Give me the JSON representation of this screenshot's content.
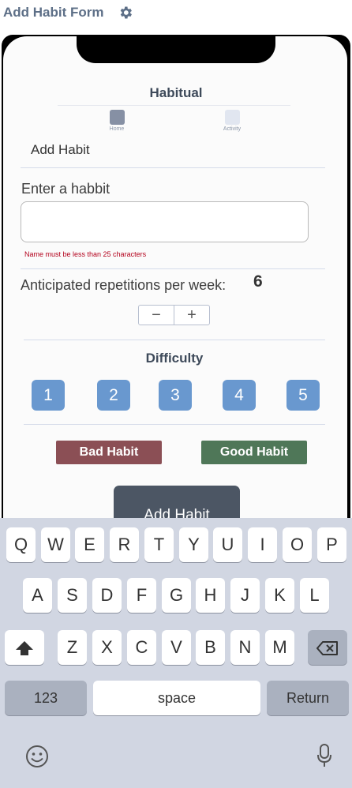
{
  "window": {
    "title": "Add Habit Form",
    "settings_icon": "gear-icon"
  },
  "app": {
    "title": "Habitual",
    "tabs": [
      {
        "label": "Home",
        "icon": "home-icon",
        "active": true
      },
      {
        "label": "Activity",
        "icon": "activity-icon",
        "active": false
      }
    ]
  },
  "form": {
    "heading": "Add Habit",
    "name_label": "Enter a habbit",
    "name_value": "",
    "name_error": "Name must be less than 25 characters",
    "reps_label": "Anticipated repetitions per week:",
    "reps_value": "6",
    "stepper": {
      "minus": "−",
      "plus": "+"
    },
    "difficulty_label": "Difficulty",
    "difficulty_options": [
      "1",
      "2",
      "3",
      "4",
      "5"
    ],
    "bad_habit_label": "Bad Habit",
    "good_habit_label": "Good Habit",
    "submit_label": "Add Habit"
  },
  "keyboard": {
    "row1": [
      "Q",
      "W",
      "E",
      "R",
      "T",
      "Y",
      "U",
      "I",
      "O",
      "P"
    ],
    "row2": [
      "A",
      "S",
      "D",
      "F",
      "G",
      "H",
      "J",
      "K",
      "L"
    ],
    "row3": [
      "Z",
      "X",
      "C",
      "V",
      "B",
      "N",
      "M"
    ],
    "numbers_label": "123",
    "space_label": "space",
    "return_label": "Return"
  },
  "colors": {
    "difficulty_button": "#6998cf",
    "bad_habit": "#8b4f55",
    "good_habit": "#4f7758",
    "submit": "#4c5664",
    "error": "#b3001b"
  }
}
